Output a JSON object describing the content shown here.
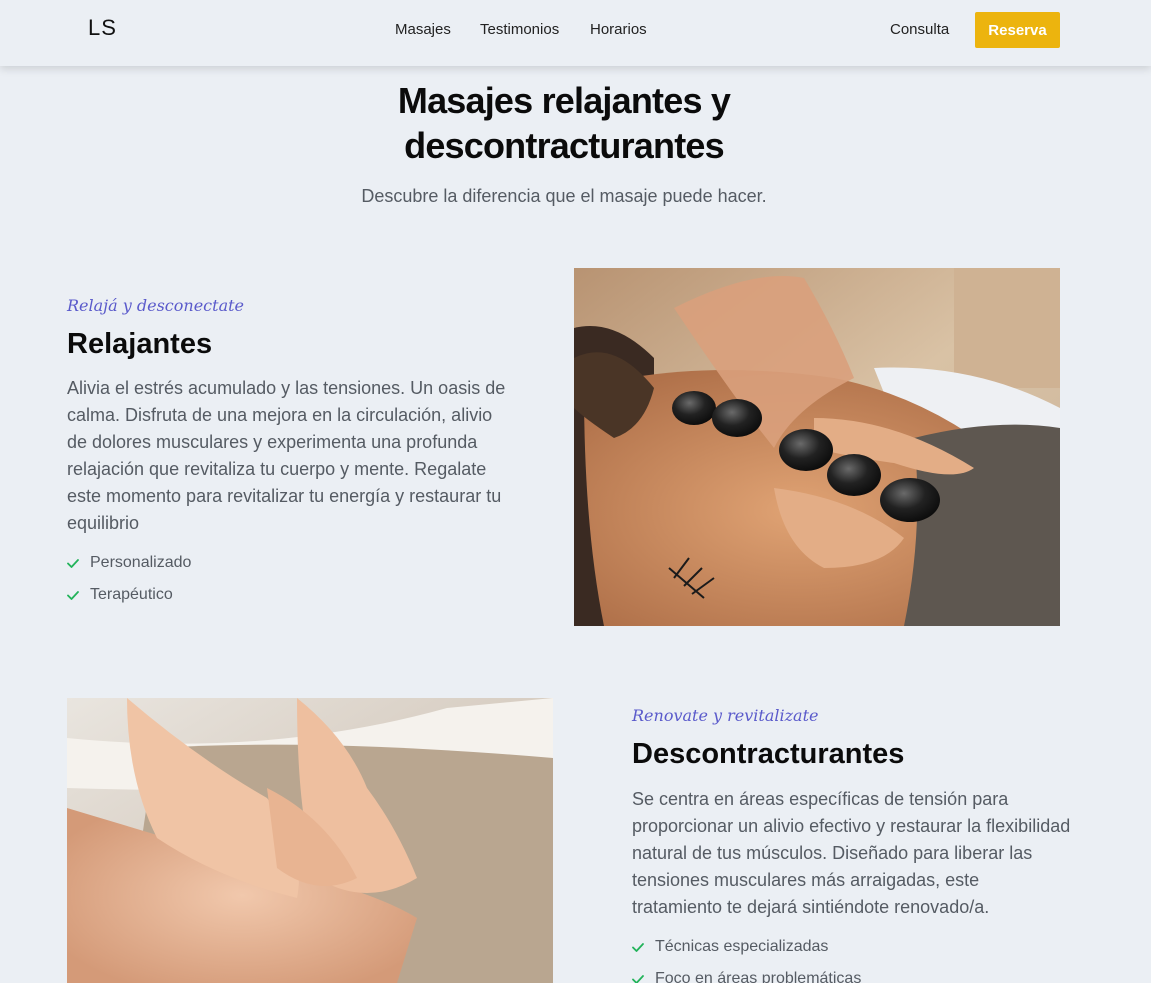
{
  "nav": {
    "logo": "LS",
    "links": [
      "Masajes",
      "Testimonios",
      "Horarios"
    ],
    "consulta": "Consulta",
    "reserva": "Reserva"
  },
  "colors": {
    "background": "#ebeff4",
    "accent": "#ecb40e",
    "tagline": "#5a5acb",
    "check": "#22b35a"
  },
  "hero": {
    "title_line1": "Masajes relajantes y",
    "title_line2": "descontracturantes",
    "subtitle": "Descubre la diferencia que el masaje puede hacer."
  },
  "sections": [
    {
      "tagline": "Relajá y desconectate",
      "title": "Relajantes",
      "description": "Alivia el estrés acumulado y las tensiones. Un oasis de calma. Disfruta de una mejora en la circulación, alivio de dolores musculares y experimenta una profunda relajación que revitaliza tu cuerpo y mente. Regalate este momento para revitalizar tu energía y restaurar tu equilibrio",
      "features": [
        "Personalizado",
        "Terapéutico"
      ],
      "image": "hot-stone-massage-photo"
    },
    {
      "tagline": "Renovate y revitalizate",
      "title": "Descontracturantes",
      "description": "Se centra en áreas específicas de tensión para proporcionar un alivio efectivo y restaurar la flexibilidad natural de tus músculos. Diseñado para liberar las tensiones musculares más arraigadas, este tratamiento te dejará sintiéndote renovado/a.",
      "features": [
        "Técnicas especializadas",
        "Foco en áreas problemáticas"
      ],
      "image": "deep-tissue-massage-photo"
    }
  ]
}
